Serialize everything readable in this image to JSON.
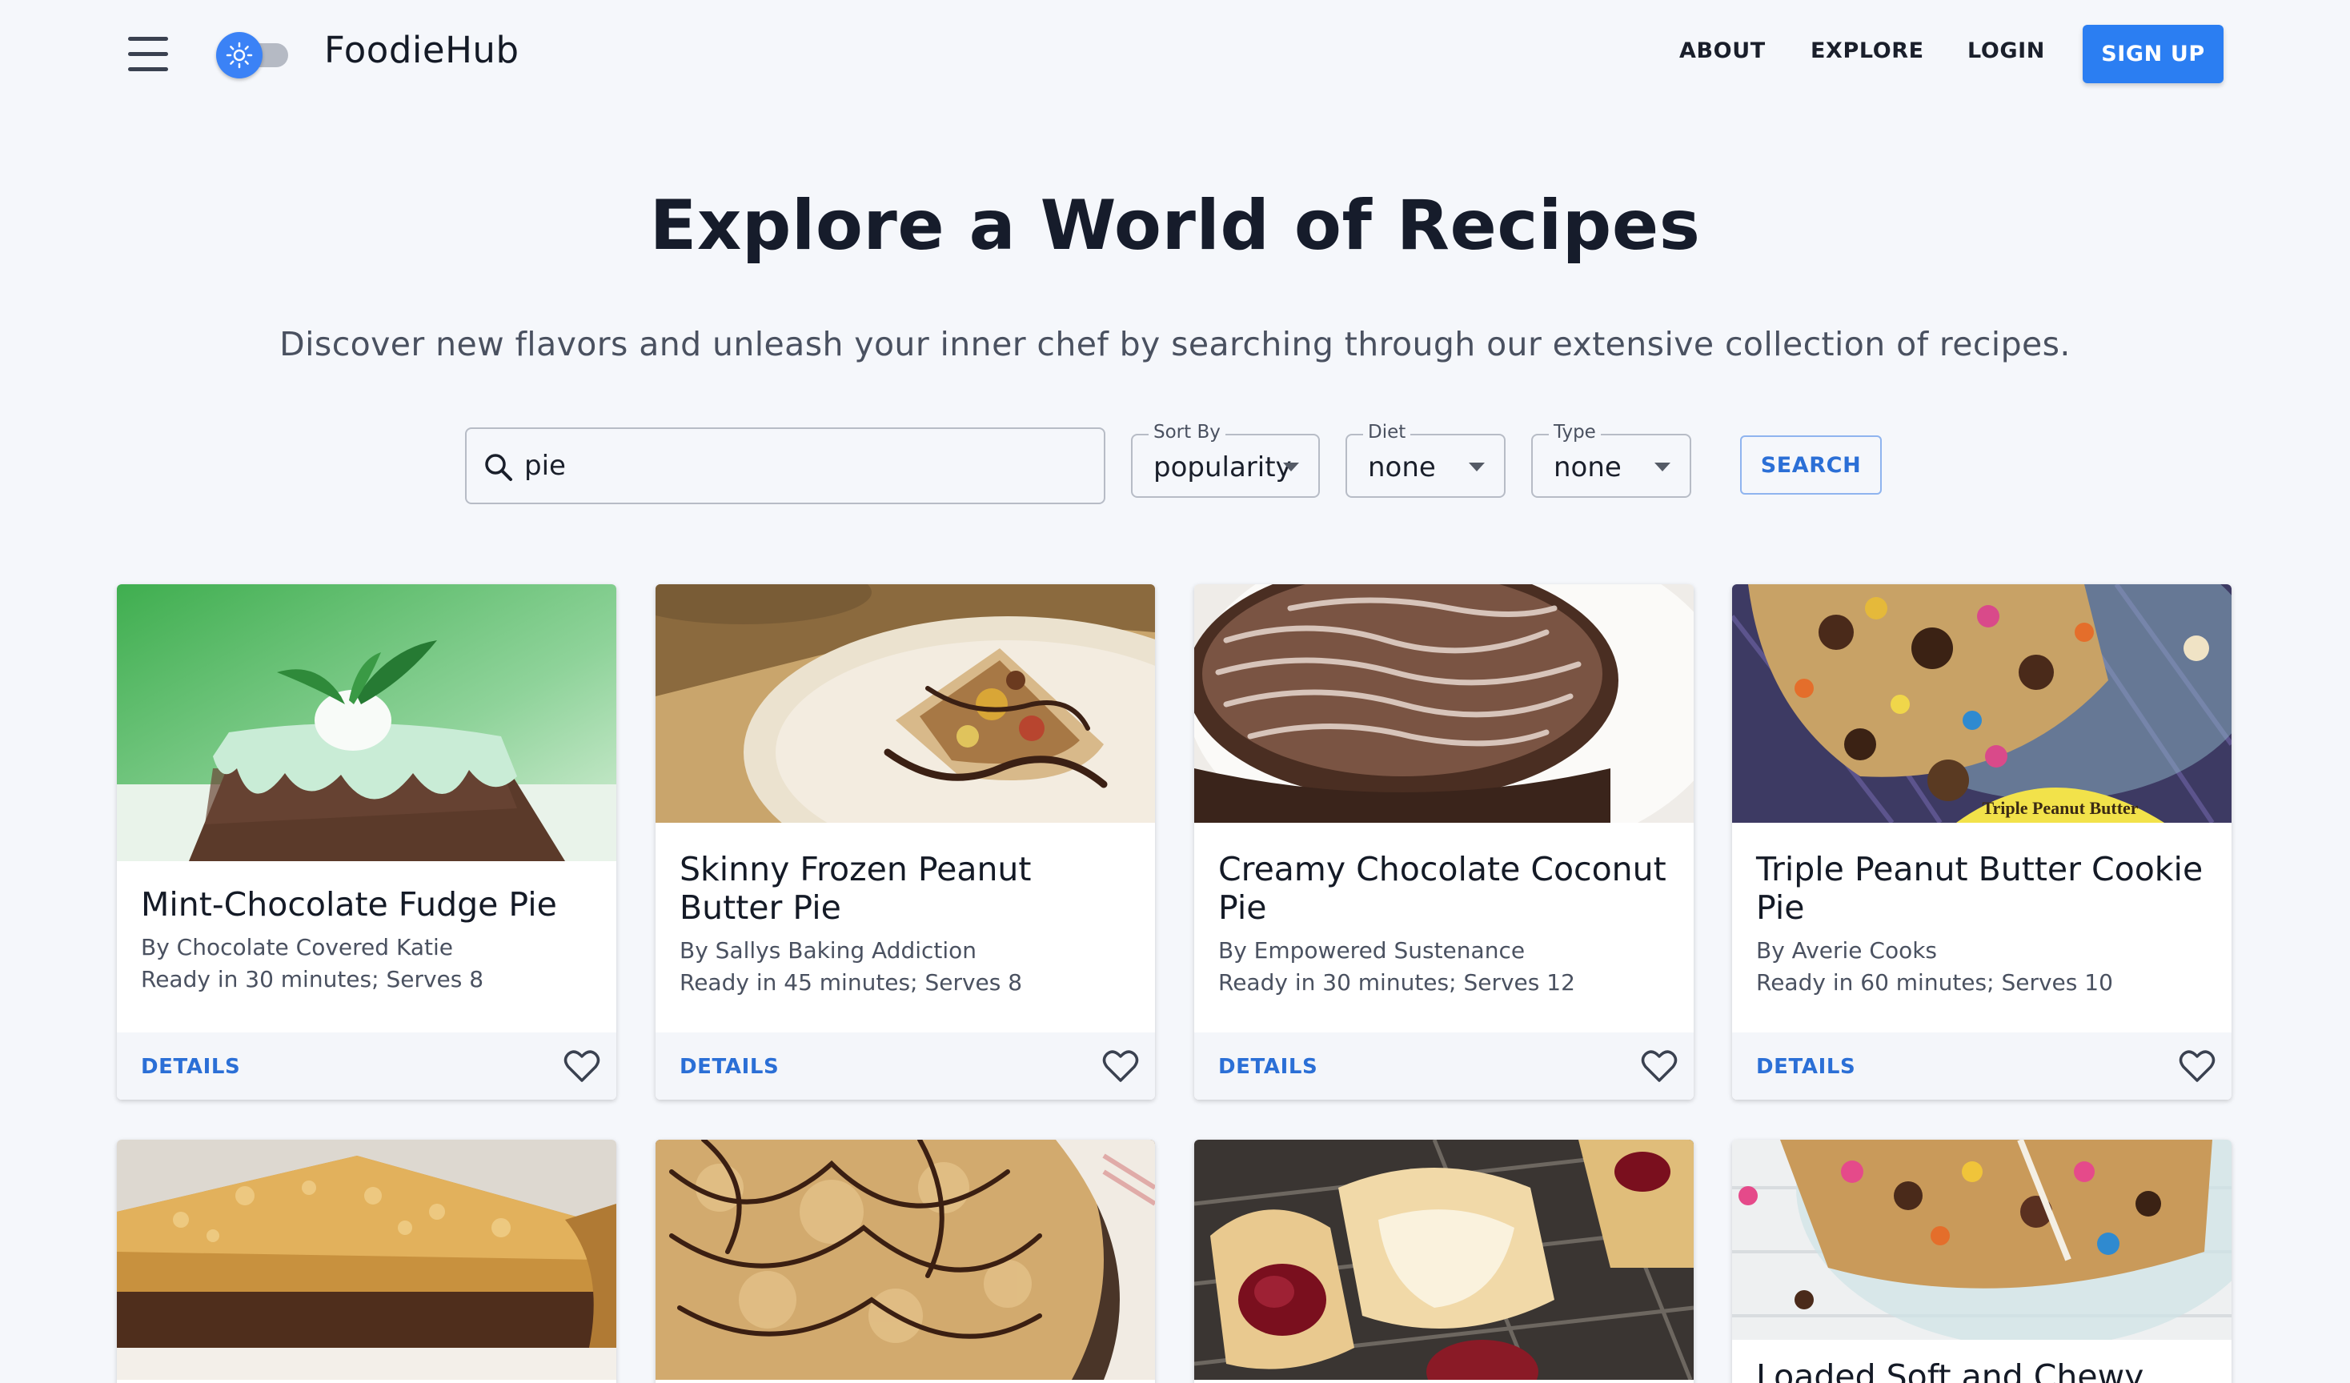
{
  "header": {
    "brand": "FoodieHub",
    "nav": [
      "ABOUT",
      "EXPLORE",
      "LOGIN"
    ],
    "signup": "SIGN UP"
  },
  "hero": {
    "title": "Explore a World of Recipes",
    "subtitle": "Discover new flavors and unleash your inner chef by searching through our extensive collection of recipes."
  },
  "search": {
    "query": "pie",
    "sort": {
      "label": "Sort By",
      "value": "popularity"
    },
    "diet": {
      "label": "Diet",
      "value": "none"
    },
    "type": {
      "label": "Type",
      "value": "none"
    },
    "button": "SEARCH"
  },
  "cards": [
    {
      "title": "Mint-Chocolate Fudge Pie",
      "author": "By Chocolate Covered Katie",
      "info": "Ready in 30 minutes; Serves 8",
      "details": "DETAILS"
    },
    {
      "title": "Skinny Frozen Peanut Butter Pie",
      "author": "By Sallys Baking Addiction",
      "info": "Ready in 45 minutes; Serves 8",
      "details": "DETAILS"
    },
    {
      "title": "Creamy Chocolate Coconut Pie",
      "author": "By Empowered Sustenance",
      "info": "Ready in 30 minutes; Serves 12",
      "details": "DETAILS"
    },
    {
      "title": "Triple Peanut Butter Cookie Pie",
      "author": "By Averie Cooks",
      "info": "Ready in 60 minutes; Serves 10",
      "details": "DETAILS",
      "image_text": "Triple Peanut Butter"
    }
  ],
  "bottom_cards": [
    {
      "title": ""
    },
    {
      "title": ""
    },
    {
      "title": ""
    },
    {
      "title": "Loaded Soft and Chewy"
    }
  ],
  "colors": {
    "accent": "#2b7ef2",
    "link": "#2b6fd6",
    "background": "#f5f7fb"
  }
}
